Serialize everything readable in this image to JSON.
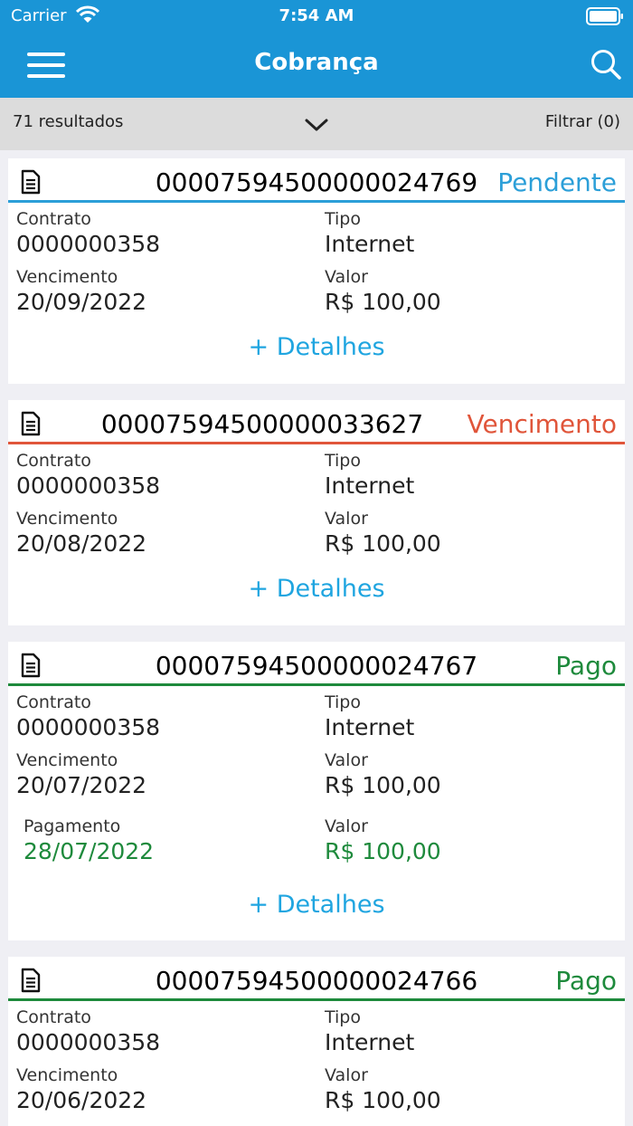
{
  "status_bar": {
    "carrier": "Carrier",
    "time": "7:54 AM"
  },
  "nav": {
    "title": "Cobrança"
  },
  "results": {
    "count_text": "71 resultados",
    "filter_label": "Filtrar (0)"
  },
  "colors": {
    "accent": "#1a95d6",
    "pending": "#2c9fd8",
    "overdue": "#e0553a",
    "paid": "#1e8a3c",
    "link": "#1fa5e0"
  },
  "cards": [
    {
      "number": "00007594500000024769",
      "status": "Pendente",
      "contract_label": "Contrato",
      "contract": "0000000358",
      "type_label": "Tipo",
      "type": "Internet",
      "due_label": "Vencimento",
      "due": "20/09/2022",
      "value_label": "Valor",
      "value": "R$ 100,00",
      "details": "+ Detalhes"
    },
    {
      "number": "00007594500000033627",
      "status": "Vencimento",
      "contract_label": "Contrato",
      "contract": "0000000358",
      "type_label": "Tipo",
      "type": "Internet",
      "due_label": "Vencimento",
      "due": "20/08/2022",
      "value_label": "Valor",
      "value": "R$ 100,00",
      "details": "+ Detalhes"
    },
    {
      "number": "00007594500000024767",
      "status": "Pago",
      "contract_label": "Contrato",
      "contract": "0000000358",
      "type_label": "Tipo",
      "type": "Internet",
      "due_label": "Vencimento",
      "due": "20/07/2022",
      "value_label": "Valor",
      "value": "R$ 100,00",
      "payment_label": "Pagamento",
      "payment_date": "28/07/2022",
      "paid_value_label": "Valor",
      "paid_value": "R$ 100,00",
      "details": "+ Detalhes"
    },
    {
      "number": "00007594500000024766",
      "status": "Pago",
      "contract_label": "Contrato",
      "contract": "0000000358",
      "type_label": "Tipo",
      "type": "Internet",
      "due_label": "Vencimento",
      "due": "20/06/2022",
      "value_label": "Valor",
      "value": "R$ 100,00"
    }
  ]
}
